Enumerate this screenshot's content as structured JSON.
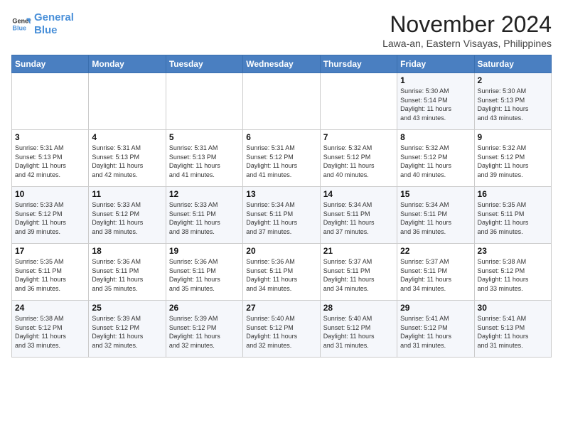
{
  "header": {
    "logo_line1": "General",
    "logo_line2": "Blue",
    "month": "November 2024",
    "location": "Lawa-an, Eastern Visayas, Philippines"
  },
  "weekdays": [
    "Sunday",
    "Monday",
    "Tuesday",
    "Wednesday",
    "Thursday",
    "Friday",
    "Saturday"
  ],
  "weeks": [
    [
      {
        "day": "",
        "info": ""
      },
      {
        "day": "",
        "info": ""
      },
      {
        "day": "",
        "info": ""
      },
      {
        "day": "",
        "info": ""
      },
      {
        "day": "",
        "info": ""
      },
      {
        "day": "1",
        "info": "Sunrise: 5:30 AM\nSunset: 5:14 PM\nDaylight: 11 hours\nand 43 minutes."
      },
      {
        "day": "2",
        "info": "Sunrise: 5:30 AM\nSunset: 5:13 PM\nDaylight: 11 hours\nand 43 minutes."
      }
    ],
    [
      {
        "day": "3",
        "info": "Sunrise: 5:31 AM\nSunset: 5:13 PM\nDaylight: 11 hours\nand 42 minutes."
      },
      {
        "day": "4",
        "info": "Sunrise: 5:31 AM\nSunset: 5:13 PM\nDaylight: 11 hours\nand 42 minutes."
      },
      {
        "day": "5",
        "info": "Sunrise: 5:31 AM\nSunset: 5:13 PM\nDaylight: 11 hours\nand 41 minutes."
      },
      {
        "day": "6",
        "info": "Sunrise: 5:31 AM\nSunset: 5:12 PM\nDaylight: 11 hours\nand 41 minutes."
      },
      {
        "day": "7",
        "info": "Sunrise: 5:32 AM\nSunset: 5:12 PM\nDaylight: 11 hours\nand 40 minutes."
      },
      {
        "day": "8",
        "info": "Sunrise: 5:32 AM\nSunset: 5:12 PM\nDaylight: 11 hours\nand 40 minutes."
      },
      {
        "day": "9",
        "info": "Sunrise: 5:32 AM\nSunset: 5:12 PM\nDaylight: 11 hours\nand 39 minutes."
      }
    ],
    [
      {
        "day": "10",
        "info": "Sunrise: 5:33 AM\nSunset: 5:12 PM\nDaylight: 11 hours\nand 39 minutes."
      },
      {
        "day": "11",
        "info": "Sunrise: 5:33 AM\nSunset: 5:12 PM\nDaylight: 11 hours\nand 38 minutes."
      },
      {
        "day": "12",
        "info": "Sunrise: 5:33 AM\nSunset: 5:11 PM\nDaylight: 11 hours\nand 38 minutes."
      },
      {
        "day": "13",
        "info": "Sunrise: 5:34 AM\nSunset: 5:11 PM\nDaylight: 11 hours\nand 37 minutes."
      },
      {
        "day": "14",
        "info": "Sunrise: 5:34 AM\nSunset: 5:11 PM\nDaylight: 11 hours\nand 37 minutes."
      },
      {
        "day": "15",
        "info": "Sunrise: 5:34 AM\nSunset: 5:11 PM\nDaylight: 11 hours\nand 36 minutes."
      },
      {
        "day": "16",
        "info": "Sunrise: 5:35 AM\nSunset: 5:11 PM\nDaylight: 11 hours\nand 36 minutes."
      }
    ],
    [
      {
        "day": "17",
        "info": "Sunrise: 5:35 AM\nSunset: 5:11 PM\nDaylight: 11 hours\nand 36 minutes."
      },
      {
        "day": "18",
        "info": "Sunrise: 5:36 AM\nSunset: 5:11 PM\nDaylight: 11 hours\nand 35 minutes."
      },
      {
        "day": "19",
        "info": "Sunrise: 5:36 AM\nSunset: 5:11 PM\nDaylight: 11 hours\nand 35 minutes."
      },
      {
        "day": "20",
        "info": "Sunrise: 5:36 AM\nSunset: 5:11 PM\nDaylight: 11 hours\nand 34 minutes."
      },
      {
        "day": "21",
        "info": "Sunrise: 5:37 AM\nSunset: 5:11 PM\nDaylight: 11 hours\nand 34 minutes."
      },
      {
        "day": "22",
        "info": "Sunrise: 5:37 AM\nSunset: 5:11 PM\nDaylight: 11 hours\nand 34 minutes."
      },
      {
        "day": "23",
        "info": "Sunrise: 5:38 AM\nSunset: 5:12 PM\nDaylight: 11 hours\nand 33 minutes."
      }
    ],
    [
      {
        "day": "24",
        "info": "Sunrise: 5:38 AM\nSunset: 5:12 PM\nDaylight: 11 hours\nand 33 minutes."
      },
      {
        "day": "25",
        "info": "Sunrise: 5:39 AM\nSunset: 5:12 PM\nDaylight: 11 hours\nand 32 minutes."
      },
      {
        "day": "26",
        "info": "Sunrise: 5:39 AM\nSunset: 5:12 PM\nDaylight: 11 hours\nand 32 minutes."
      },
      {
        "day": "27",
        "info": "Sunrise: 5:40 AM\nSunset: 5:12 PM\nDaylight: 11 hours\nand 32 minutes."
      },
      {
        "day": "28",
        "info": "Sunrise: 5:40 AM\nSunset: 5:12 PM\nDaylight: 11 hours\nand 31 minutes."
      },
      {
        "day": "29",
        "info": "Sunrise: 5:41 AM\nSunset: 5:12 PM\nDaylight: 11 hours\nand 31 minutes."
      },
      {
        "day": "30",
        "info": "Sunrise: 5:41 AM\nSunset: 5:13 PM\nDaylight: 11 hours\nand 31 minutes."
      }
    ]
  ]
}
